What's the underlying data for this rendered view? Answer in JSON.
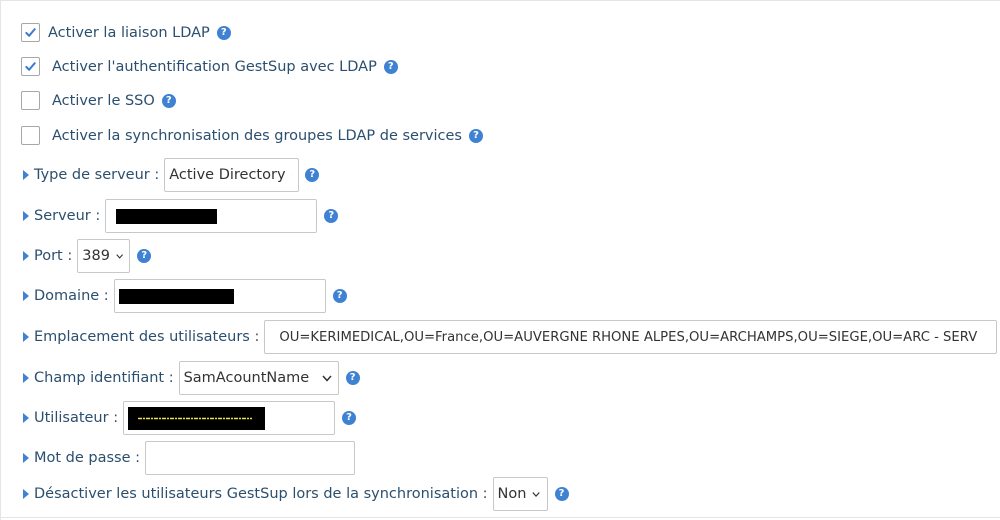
{
  "checkboxes": [
    {
      "label": "Activer la liaison LDAP",
      "checked": true
    },
    {
      "label": "Activer l'authentification GestSup avec LDAP",
      "checked": true
    },
    {
      "label": "Activer le SSO",
      "checked": false
    },
    {
      "label": "Activer la synchronisation des groupes LDAP de services",
      "checked": false
    }
  ],
  "fields": {
    "server_type": {
      "label": "Type de serveur :",
      "value": "Active Directory"
    },
    "server": {
      "label": "Serveur :",
      "value": ""
    },
    "port": {
      "label": "Port :",
      "value": "389"
    },
    "domain": {
      "label": "Domaine :",
      "value": ""
    },
    "users_location": {
      "label": "Emplacement des utilisateurs :",
      "value": "OU=KERIMEDICAL,OU=France,OU=AUVERGNE RHONE ALPES,OU=ARCHAMPS,OU=SIEGE,OU=ARC - SERV"
    },
    "id_field": {
      "label": "Champ identifiant :",
      "value": "SamAcountName"
    },
    "user": {
      "label": "Utilisateur :",
      "value": ""
    },
    "password": {
      "label": "Mot de passe :",
      "value": ""
    },
    "disable_users": {
      "label": "Désactiver les utilisateurs GestSup lors de la synchronisation :",
      "value": "Non"
    }
  },
  "help_glyph": "?",
  "icons": {
    "help": "help-circle-icon",
    "caret": "caret-right-icon",
    "check": "check-icon",
    "dropdown": "chevron-down-icon"
  },
  "colors": {
    "accent": "#3f82d2",
    "label_text": "#2b4f6e",
    "check": "#3a7bd0"
  }
}
